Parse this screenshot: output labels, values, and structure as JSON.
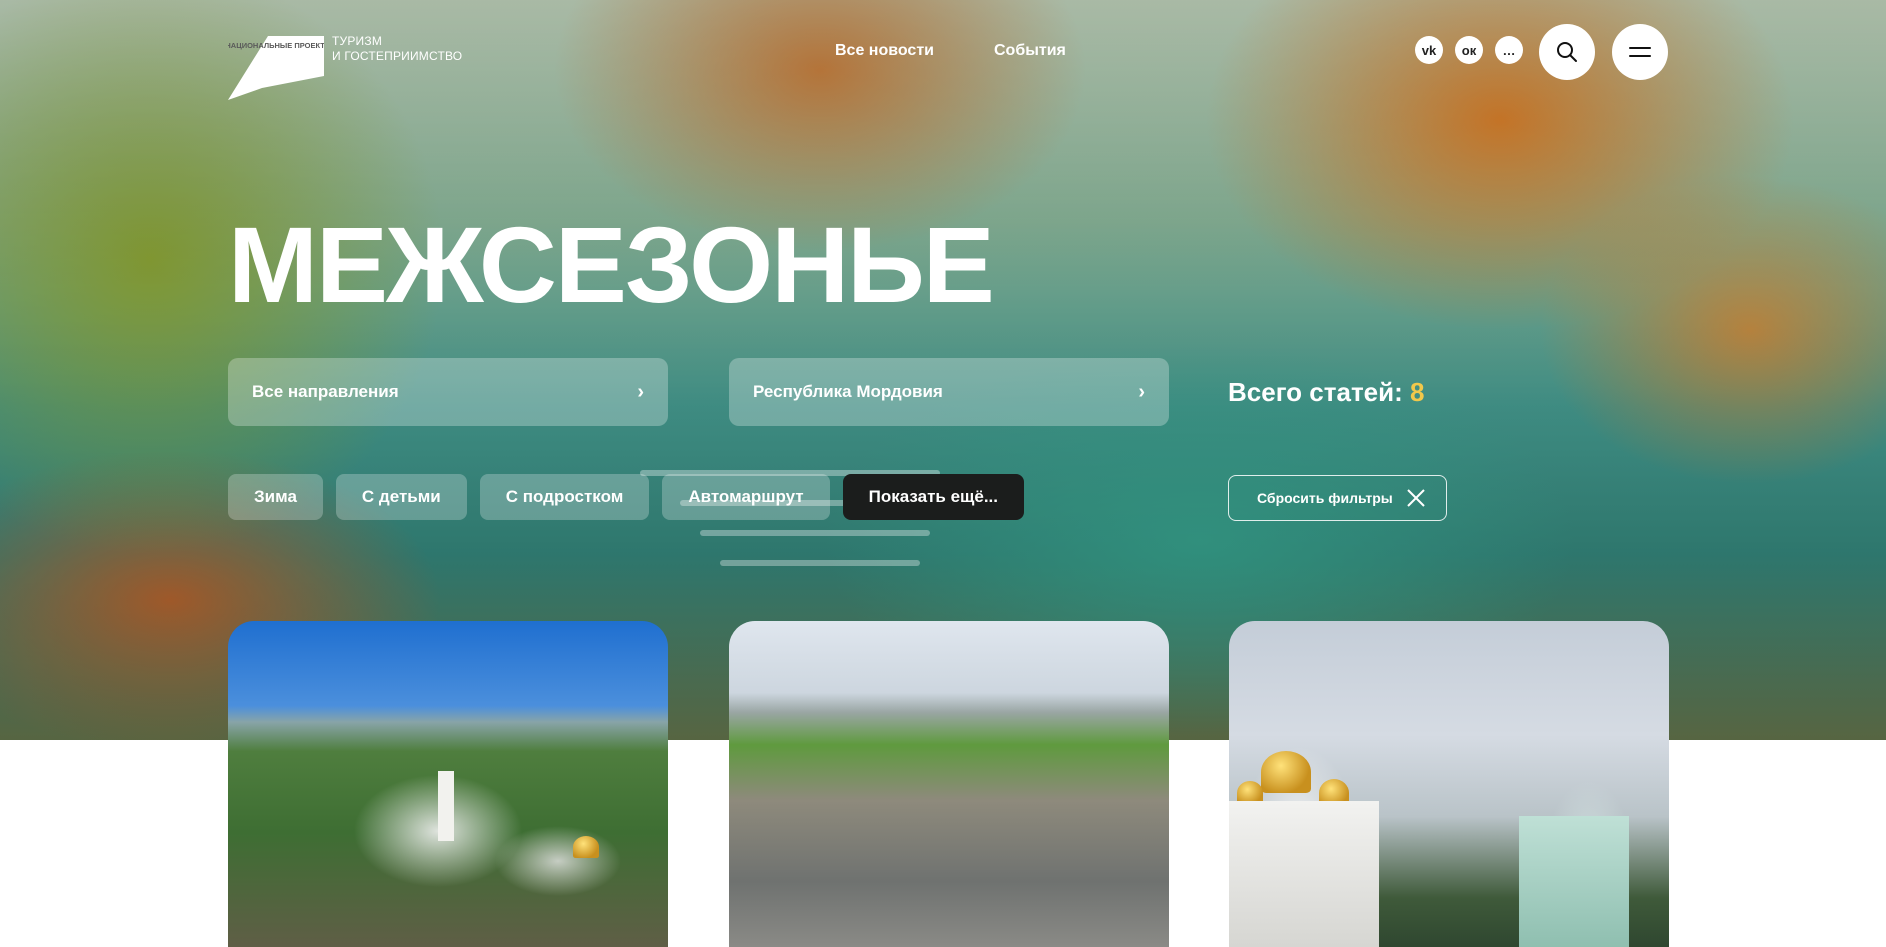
{
  "logo": {
    "mark_text": "НАЦИОНАЛЬНЫЕ ПРОЕКТЫ РОССИИ",
    "line1": "ТУРИЗМ",
    "line2": "И ГОСТЕПРИИМСТВО"
  },
  "nav": {
    "news": "Все новости",
    "events": "События"
  },
  "socials": [
    {
      "icon": "vk-icon",
      "glyph": "vk"
    },
    {
      "icon": "ok-icon",
      "glyph": "ок"
    },
    {
      "icon": "chat-icon",
      "glyph": "…"
    }
  ],
  "header_buttons": {
    "search_icon": "search-icon",
    "menu_icon": "menu-icon"
  },
  "page_title": "МЕЖСЕЗОНЬЕ",
  "filters": {
    "direction": "Все направления",
    "region": "Республика Мордовия",
    "total_label": "Всего статей:",
    "total_count": "8",
    "chips": [
      "Зима",
      "С детьми",
      "С подростком",
      "Автомаршрут"
    ],
    "more": "Показать ещё...",
    "reset": "Сбросить фильтры"
  },
  "cards": [
    {
      "image": "aerial-monastery-photo"
    },
    {
      "image": "aerial-city-photo"
    },
    {
      "image": "cathedral-domes-photo"
    }
  ],
  "colors": {
    "accent_count": "#f2c84b",
    "dark_chip": "#1b1d1c",
    "white": "#ffffff"
  }
}
